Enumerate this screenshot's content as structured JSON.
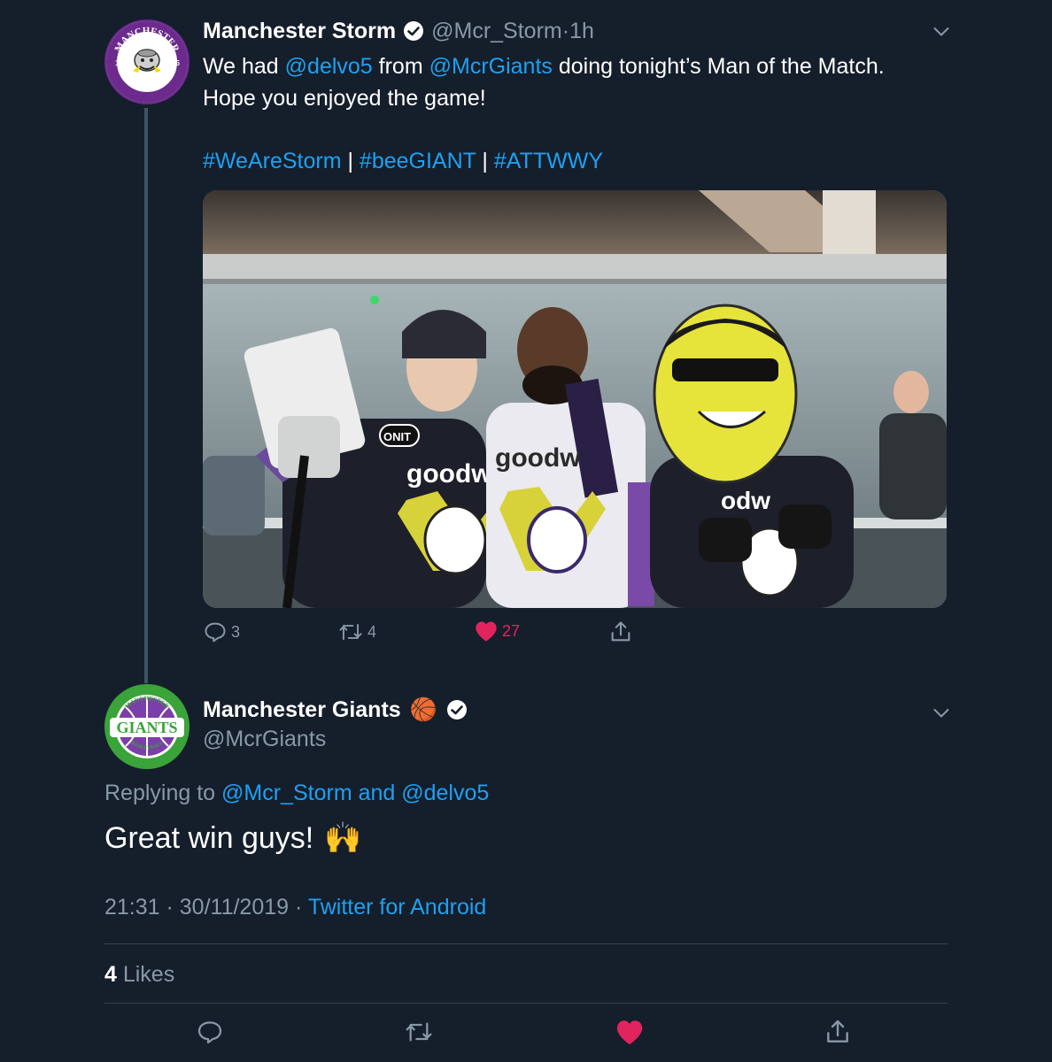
{
  "tweet1": {
    "name": "Manchester Storm",
    "handle": "@Mcr_Storm",
    "separator": " · ",
    "time": "1h",
    "text_parts": {
      "p1": "We had ",
      "mention1": "@delvo5",
      "p2": " from ",
      "mention2": "@McrGiants",
      "p3": " doing tonight’s Man of the Match.",
      "line2": "Hope you enjoyed the game!"
    },
    "hashtags": {
      "tag1": "#WeAreStorm",
      "sep1": " | ",
      "tag2": "#beeGIANT",
      "sep2": " | ",
      "tag3": "#ATTWWY"
    },
    "avatar_text": {
      "top": "MANCHESTER",
      "bottom": "STORM",
      "left": "19",
      "right": "95"
    },
    "photo_text": {
      "jersey1": "goodwin",
      "jersey2": "goodw",
      "jersey3": "odw",
      "sponsor": "ONIT"
    },
    "actions": {
      "replies": "3",
      "retweets": "4",
      "likes": "27"
    }
  },
  "tweet2": {
    "name": "Manchester Giants",
    "emoji": "🏀",
    "handle": "@McrGiants",
    "avatar_text": "GIANTS",
    "avatar_ring_top": "MANCHESTER",
    "avatar_ring_bottom": "BASKETBALL",
    "replying_label": "Replying to ",
    "replying_to": "@Mcr_Storm and @delvo5",
    "text": "Great win guys!",
    "text_emoji": "🙌",
    "time": "21:31",
    "separator": " · ",
    "date": "30/11/2019",
    "source_sep": " · ",
    "source": "Twitter for Android",
    "likes_count": "4",
    "likes_label": " Likes"
  },
  "colors": {
    "background": "#151e2b",
    "link": "#1da1f2",
    "muted": "#8899a6",
    "like": "#e0245e",
    "divider": "#38444d",
    "storm_purple": "#6b2a8c",
    "giants_green": "#3aa33a"
  }
}
